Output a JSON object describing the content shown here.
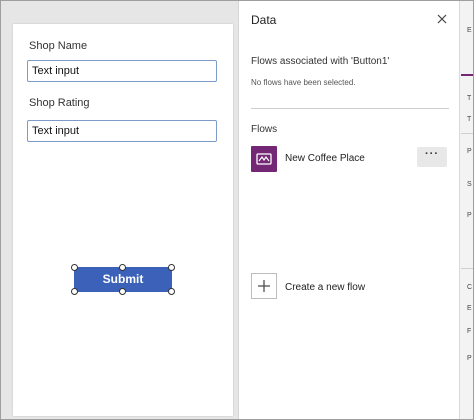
{
  "canvas": {
    "fields": [
      {
        "label": "Shop Name",
        "value": "Text input"
      },
      {
        "label": "Shop Rating",
        "value": "Text input"
      }
    ],
    "submit_label": "Submit"
  },
  "panel": {
    "title": "Data",
    "associated_heading": "Flows associated with 'Button1'",
    "associated_empty": "No flows have been selected.",
    "flows_heading": "Flows",
    "flows": [
      {
        "name": "New Coffee Place",
        "icon": "power-automate-flow-icon",
        "color": "#742774",
        "more_label": "···"
      }
    ],
    "create_label": "Create a new flow"
  },
  "right_strip": {
    "chars": [
      "E",
      "T",
      "T",
      "P",
      "S",
      "P",
      "C",
      "E",
      "F",
      "P"
    ]
  },
  "colors": {
    "accent_button": "#3b62b8",
    "flow_icon": "#742774"
  }
}
